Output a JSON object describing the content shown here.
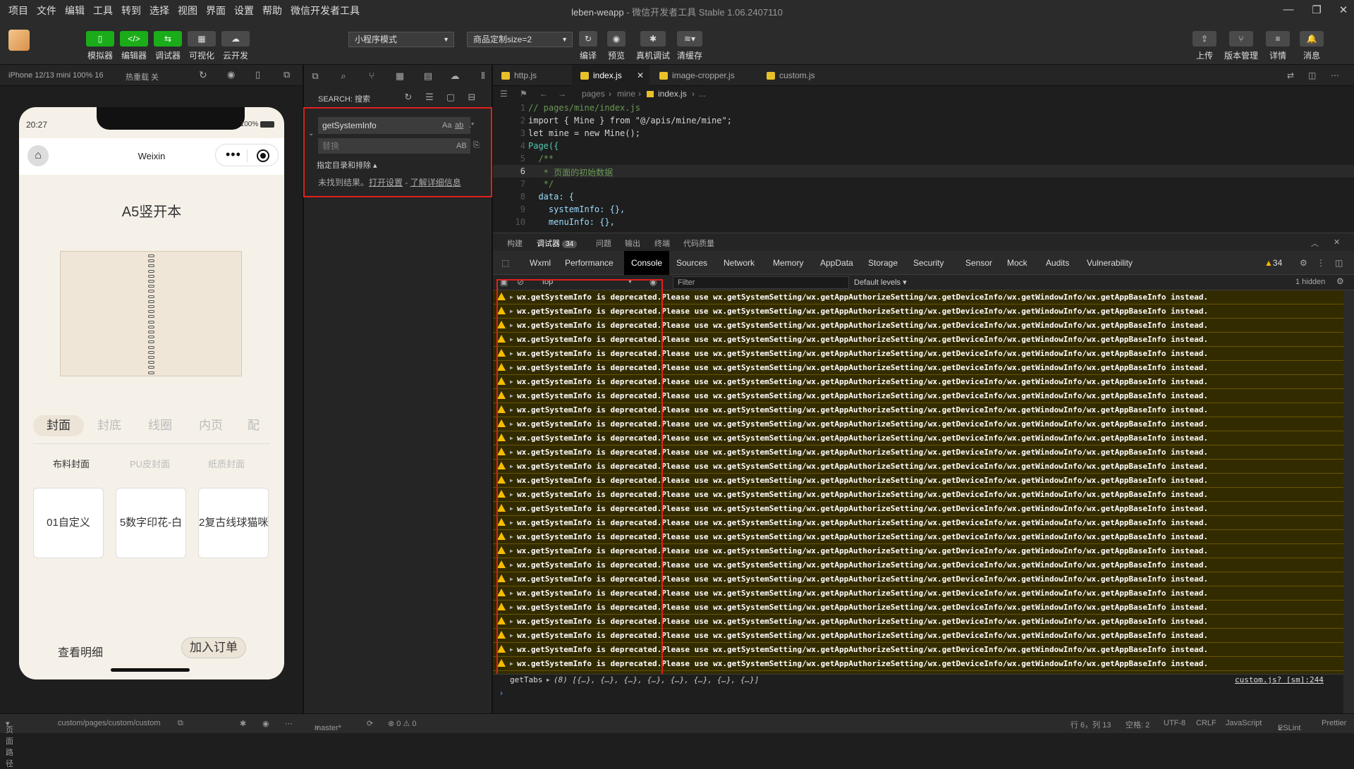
{
  "menubar": {
    "items": [
      "项目",
      "文件",
      "编辑",
      "工具",
      "转到",
      "选择",
      "视图",
      "界面",
      "设置",
      "帮助",
      "微信开发者工具"
    ],
    "title_project": "leben-weapp",
    "title_suffix": " - 微信开发者工具 Stable 1.06.2407110"
  },
  "toolbar": {
    "left_buttons": [
      {
        "label": "模拟器",
        "icon": "phone-icon"
      },
      {
        "label": "编辑器",
        "icon": "code-icon"
      },
      {
        "label": "调试器",
        "icon": "debug-icon"
      },
      {
        "label": "可视化",
        "icon": "layout-icon"
      },
      {
        "label": "云开发",
        "icon": "cloud-icon"
      }
    ],
    "mode_select": "小程序模式",
    "compile_select": "商品定制size=2",
    "mid_buttons": [
      {
        "label": "编译",
        "icon": "refresh-icon"
      },
      {
        "label": "预览",
        "icon": "eye-icon"
      },
      {
        "label": "真机调试",
        "icon": "bug-icon"
      },
      {
        "label": "清缓存",
        "icon": "layers-icon"
      }
    ],
    "right_buttons": [
      {
        "label": "上传",
        "icon": "upload-icon"
      },
      {
        "label": "版本管理",
        "icon": "branch-icon"
      },
      {
        "label": "详情",
        "icon": "menu-icon"
      },
      {
        "label": "消息",
        "icon": "bell-icon"
      }
    ]
  },
  "simulator": {
    "device": "iPhone 12/13 mini 100% 16",
    "hot_reload": "热重载 关",
    "time": "20:27",
    "battery": "100%",
    "nav_title": "Weixin",
    "page_title": "A5竖开本",
    "tabs": [
      "封面",
      "封底",
      "线圈",
      "内页",
      "配"
    ],
    "subtabs": [
      "布料封面",
      "PU皮封面",
      "纸质封面"
    ],
    "cards": [
      "01自定义",
      "5数字印花-白",
      "2复古线球猫咪"
    ],
    "detail_label": "查看明细",
    "order_button": "加入订单"
  },
  "search": {
    "header": "SEARCH: 搜索",
    "query": "getSystemInfo",
    "replace_placeholder": "替换",
    "case_option": "Aa",
    "word_option": "ab",
    "regex_option": ".*",
    "preserve_case": "AB",
    "include_exclude": "指定目录和排除",
    "no_result": "未找到结果。",
    "open_settings": "打开设置",
    "separator": " - ",
    "learn_more": "了解详细信息"
  },
  "editor": {
    "tabs": [
      "http.js",
      "index.js",
      "image-cropper.js",
      "custom.js"
    ],
    "active_tab": 1,
    "breadcrumb": [
      "pages",
      "mine",
      "index.js",
      "..."
    ],
    "lines": [
      {
        "n": "1",
        "text": "// pages/mine/index.js"
      },
      {
        "n": "2",
        "text": "import { Mine } from \"@/apis/mine/mine\";"
      },
      {
        "n": "3",
        "text": "let mine = new Mine();"
      },
      {
        "n": "4",
        "text": "Page({"
      },
      {
        "n": "5",
        "text": "  /**"
      },
      {
        "n": "6",
        "text": "   * 页面的初始数据"
      },
      {
        "n": "7",
        "text": "   */"
      },
      {
        "n": "8",
        "text": "  data: {"
      },
      {
        "n": "9",
        "text": "    systemInfo: {},"
      },
      {
        "n": "10",
        "text": "    menuInfo: {},"
      }
    ]
  },
  "panel": {
    "tabs": [
      "构建",
      "调试器",
      "问题",
      "输出",
      "终端",
      "代码质量"
    ],
    "debugger_badge": "34",
    "devtools_tabs": [
      "Wxml",
      "Performance",
      "Console",
      "Sources",
      "Network",
      "Memory",
      "AppData",
      "Storage",
      "Security",
      "Sensor",
      "Mock",
      "Audits",
      "Vulnerability"
    ],
    "active_devtool": "Console",
    "warning_count": "34",
    "context": "top",
    "filter_placeholder": "Filter",
    "levels": "Default levels",
    "hidden": "1 hidden",
    "warning_message": "wx.getSystemInfo is deprecated.Please use wx.getSystemSetting/wx.getAppAuthorizeSetting/wx.getDeviceInfo/wx.getWindowInfo/wx.getAppBaseInfo instead.",
    "warning_rows": 27,
    "log_label": "getTabs",
    "log_value": "(8) [{…}, {…}, {…}, {…}, {…}, {…}, {…}, {…}]",
    "log_source": "custom.js? [sm]:244"
  },
  "statusbar": {
    "page_path_label": "页面路径",
    "page_path": "custom/pages/custom/custom",
    "branch": "master*",
    "problems": "⊗ 0 ⚠ 0",
    "cursor": "行 6，列 13",
    "spaces": "空格: 2",
    "encoding": "UTF-8",
    "eol": "CRLF",
    "language": "JavaScript",
    "eslint": "ESLint",
    "prettier": "Prettier"
  }
}
